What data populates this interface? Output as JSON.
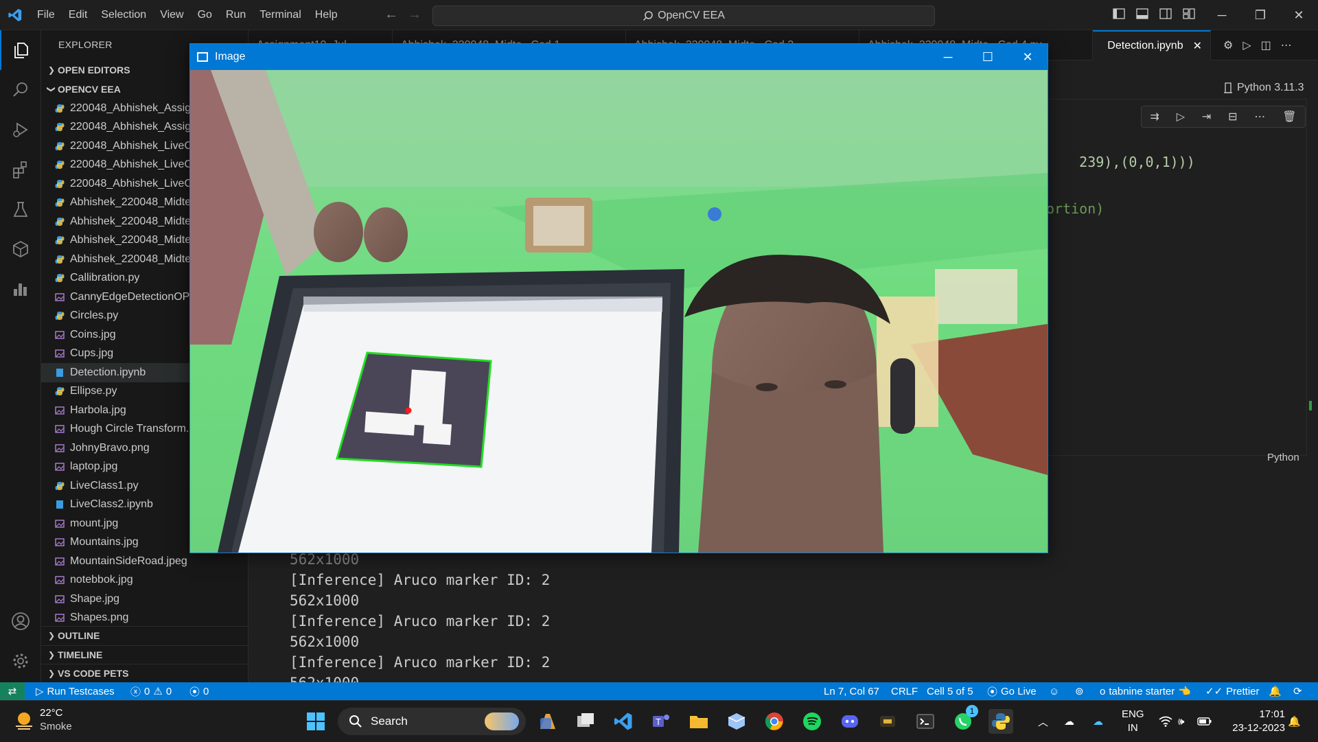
{
  "titlebar": {
    "menu": [
      "File",
      "Edit",
      "Selection",
      "View",
      "Go",
      "Run",
      "Terminal",
      "Help"
    ],
    "command_center": "OpenCV EEA"
  },
  "sidebar": {
    "title": "EXPLORER",
    "open_editors": "OPEN EDITORS",
    "folder": "OPENCV EEA",
    "files": [
      {
        "name": "220048_Abhishek_Assig",
        "type": "py"
      },
      {
        "name": "220048_Abhishek_Assig",
        "type": "py"
      },
      {
        "name": "220048_Abhishek_LiveCl",
        "type": "py"
      },
      {
        "name": "220048_Abhishek_LiveCl",
        "type": "py"
      },
      {
        "name": "220048_Abhishek_LiveCl",
        "type": "py"
      },
      {
        "name": "Abhishek_220048_Midte",
        "type": "py"
      },
      {
        "name": "Abhishek_220048_Midte",
        "type": "py"
      },
      {
        "name": "Abhishek_220048_Midte",
        "type": "py"
      },
      {
        "name": "Abhishek_220048_Midte",
        "type": "py"
      },
      {
        "name": "Callibration.py",
        "type": "py"
      },
      {
        "name": "CannyEdgeDetectionOP",
        "type": "img"
      },
      {
        "name": "Circles.py",
        "type": "py"
      },
      {
        "name": "Coins.jpg",
        "type": "img"
      },
      {
        "name": "Cups.jpg",
        "type": "img"
      },
      {
        "name": "Detection.ipynb",
        "type": "nb"
      },
      {
        "name": "Ellipse.py",
        "type": "py"
      },
      {
        "name": "Harbola.jpg",
        "type": "img"
      },
      {
        "name": "Hough Circle Transform.",
        "type": "img"
      },
      {
        "name": "JohnyBravo.png",
        "type": "img"
      },
      {
        "name": "laptop.jpg",
        "type": "img"
      },
      {
        "name": "LiveClass1.py",
        "type": "py"
      },
      {
        "name": "LiveClass2.ipynb",
        "type": "nb"
      },
      {
        "name": "mount.jpg",
        "type": "img"
      },
      {
        "name": "Mountains.jpg",
        "type": "img"
      },
      {
        "name": "MountainSideRoad.jpeg",
        "type": "img"
      },
      {
        "name": "notebbok.jpg",
        "type": "img"
      },
      {
        "name": "Shape.jpg",
        "type": "img"
      },
      {
        "name": "Shapes.png",
        "type": "img"
      }
    ],
    "selected_file": "Detection.ipynb",
    "bottom_sections": [
      "OUTLINE",
      "TIMELINE",
      "VS CODE PETS"
    ]
  },
  "editor": {
    "tabs": [
      {
        "label": "Assignment10_Jul"
      },
      {
        "label": "Abhishek_220048_Midte...Cod 1"
      },
      {
        "label": "Abhishek_220048_Midte...Cod 2"
      },
      {
        "label": "Abhishek_220048_Midte...Cod 4.py"
      },
      {
        "label": "Detection.ipynb"
      }
    ],
    "kernel": "Python 3.11.3",
    "code_fragment_1": "239),(0,0,1)))",
    "code_fragment_2": "ortion)",
    "cell_language": "Python",
    "output_lines": [
      "[Inference] Aruco marker ID: 2",
      "562x1000",
      "[Inference] Aruco marker ID: 2",
      "562x1000",
      "[Inference] Aruco marker ID: 2",
      "562x1000"
    ],
    "output_partial": "562x1000"
  },
  "image_window": {
    "title": "Image"
  },
  "statusbar": {
    "run_testcases": "Run Testcases",
    "errors": "0",
    "warnings": "0",
    "ports": "0",
    "position": "Ln 7, Col 67",
    "eol": "CRLF",
    "cell": "Cell 5 of 5",
    "go_live": "Go Live",
    "tabnine": "tabnine starter",
    "prettier": "Prettier"
  },
  "taskbar": {
    "temperature": "22°C",
    "weather": "Smoke",
    "search_placeholder": "Search",
    "language_top": "ENG",
    "language_bottom": "IN",
    "time": "17:01",
    "date": "23-12-2023",
    "whatsapp_badge": "1"
  },
  "colors": {
    "accent": "#0078d4",
    "marker_outline": "#22dd22",
    "marker_center": "#ff1a1a"
  }
}
